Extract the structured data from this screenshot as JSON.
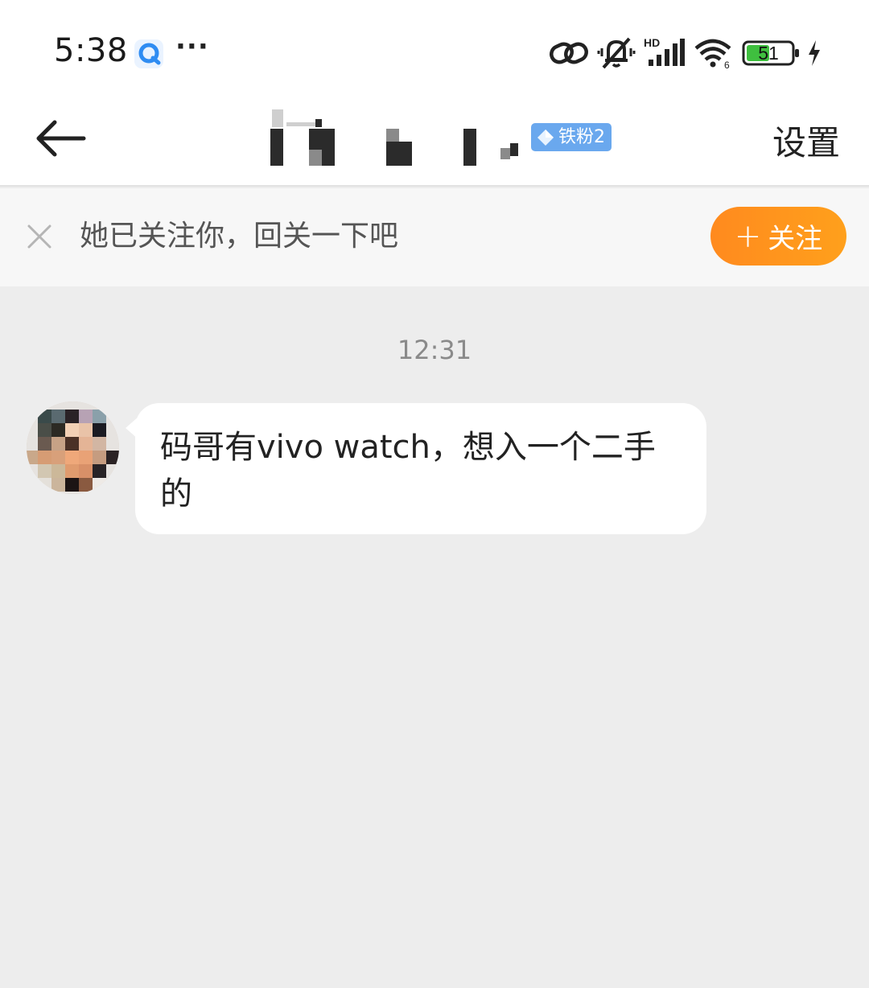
{
  "status_bar": {
    "time": "5:38",
    "more": "···",
    "battery_level": "51",
    "icons": [
      "app-notification-icon",
      "link-icon",
      "vibrate-mute-icon",
      "hd-signal-icon",
      "wifi-icon",
      "battery-icon",
      "charging-icon"
    ]
  },
  "nav": {
    "fan_badge_label": "铁粉2",
    "settings_label": "设置"
  },
  "follow_banner": {
    "text": "她已关注你，回关一下吧",
    "button_plus": "+",
    "button_label": "关注"
  },
  "chat": {
    "timestamp": "12:31",
    "messages": [
      {
        "sender": "other",
        "text": "码哥有vivo watch，想入一个二手的"
      }
    ]
  },
  "colors": {
    "accent_orange": "#ff8a1e",
    "badge_blue": "#6aa8ee",
    "chat_background": "#ededed"
  }
}
